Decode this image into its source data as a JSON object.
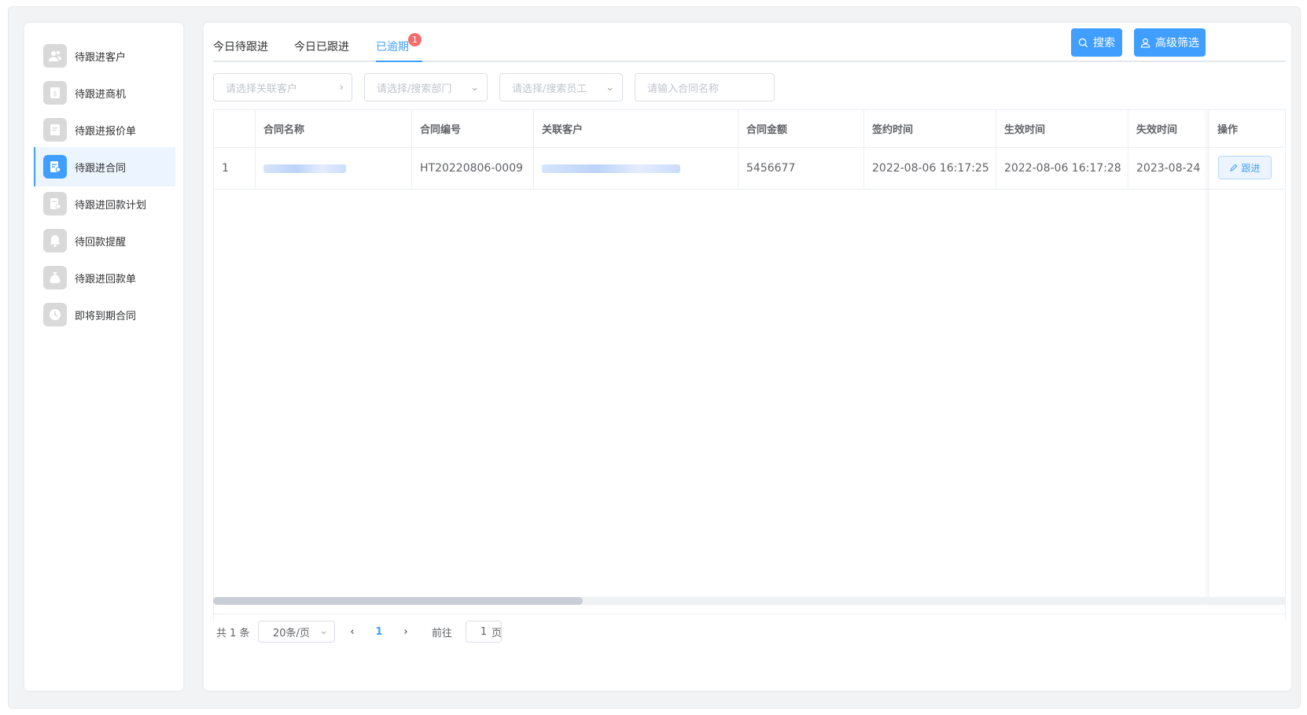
{
  "sidebar": {
    "items": [
      {
        "label": "待跟进客户",
        "icon": "customer-icon"
      },
      {
        "label": "待跟进商机",
        "icon": "opportunity-icon"
      },
      {
        "label": "待跟进报价单",
        "icon": "quote-icon"
      },
      {
        "label": "待跟进合同",
        "icon": "contract-icon",
        "active": true
      },
      {
        "label": "待跟进回款计划",
        "icon": "payment-plan-icon"
      },
      {
        "label": "待回款提醒",
        "icon": "bell-icon"
      },
      {
        "label": "待跟进回款单",
        "icon": "money-bag-icon"
      },
      {
        "label": "即将到期合同",
        "icon": "clock-icon"
      }
    ]
  },
  "tabs": [
    {
      "label": "今日待跟进"
    },
    {
      "label": "今日已跟进"
    },
    {
      "label": "已逾期",
      "badge": "1",
      "active": true
    }
  ],
  "toolbar": {
    "search_label": "搜索",
    "advanced_label": "高级筛选",
    "accent": "#409eff"
  },
  "filters": {
    "customer_placeholder": "请选择关联客户",
    "department_placeholder": "请选择/搜索部门",
    "employee_placeholder": "请选择/搜索员工",
    "contract_name_placeholder": "请输入合同名称"
  },
  "table": {
    "columns": [
      "",
      "合同名称",
      "合同编号",
      "关联客户",
      "合同金额",
      "签约时间",
      "生效时间",
      "失效时间",
      "操作"
    ],
    "rows": [
      {
        "index": "1",
        "contract_no": "HT20220806-0009",
        "amount": "5456677",
        "sign_time": "2022-08-06 16:17:25",
        "effective_time": "2022-08-06 16:17:28",
        "expire_time": "2023-08-24",
        "action": "跟进"
      }
    ]
  },
  "pagination": {
    "total_label": "共 1 条",
    "page_size": "20条/页",
    "current_page": "1",
    "goto_label": "前往",
    "goto_value": "1",
    "page_unit": "页"
  }
}
